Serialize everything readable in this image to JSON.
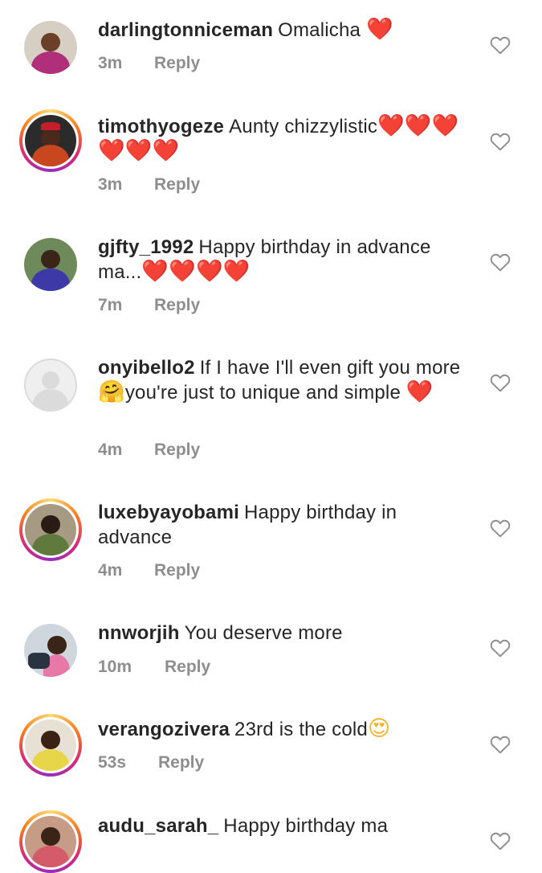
{
  "comments": [
    {
      "username": "darlingtonniceman",
      "text_before": "Omalicha ",
      "emoji_after": "❤️",
      "time": "3m",
      "reply": "Reply"
    },
    {
      "username": "timothyogeze",
      "text_before": "Aunty chizzylistic",
      "emoji_after": "❤️❤️❤️❤️❤️❤️",
      "time": "3m",
      "reply": "Reply"
    },
    {
      "username": "gjfty_1992",
      "text_before": "Happy birthday in advance ma...",
      "emoji_after": "❤️❤️❤️❤️",
      "time": "7m",
      "reply": "Reply"
    },
    {
      "username": "onyibello2",
      "text_before": "If I have I'll even gift you more",
      "emoji_mid": "🤗",
      "text_after": "you're just to unique and simple ",
      "emoji_after": "❤️",
      "time": "4m",
      "reply": "Reply"
    },
    {
      "username": "luxebyayobami",
      "text_before": "Happy birthday in advance",
      "emoji_after": "",
      "time": "4m",
      "reply": "Reply"
    },
    {
      "username": "nnworjih",
      "text_before": "You deserve more",
      "emoji_after": "",
      "time": "10m",
      "reply": "Reply"
    },
    {
      "username": "verangozivera",
      "text_before": "23rd is the cold",
      "emoji_after": "😍",
      "time": "53s",
      "reply": "Reply"
    },
    {
      "username": "audu_sarah_",
      "text_before": "Happy birthday ma",
      "emoji_after": "",
      "time": "",
      "reply": ""
    }
  ],
  "icons": {
    "like": "heart-outline-icon"
  },
  "colors": {
    "muted": "#8e8e8e",
    "heart": "#e0202e",
    "text": "#262626"
  }
}
